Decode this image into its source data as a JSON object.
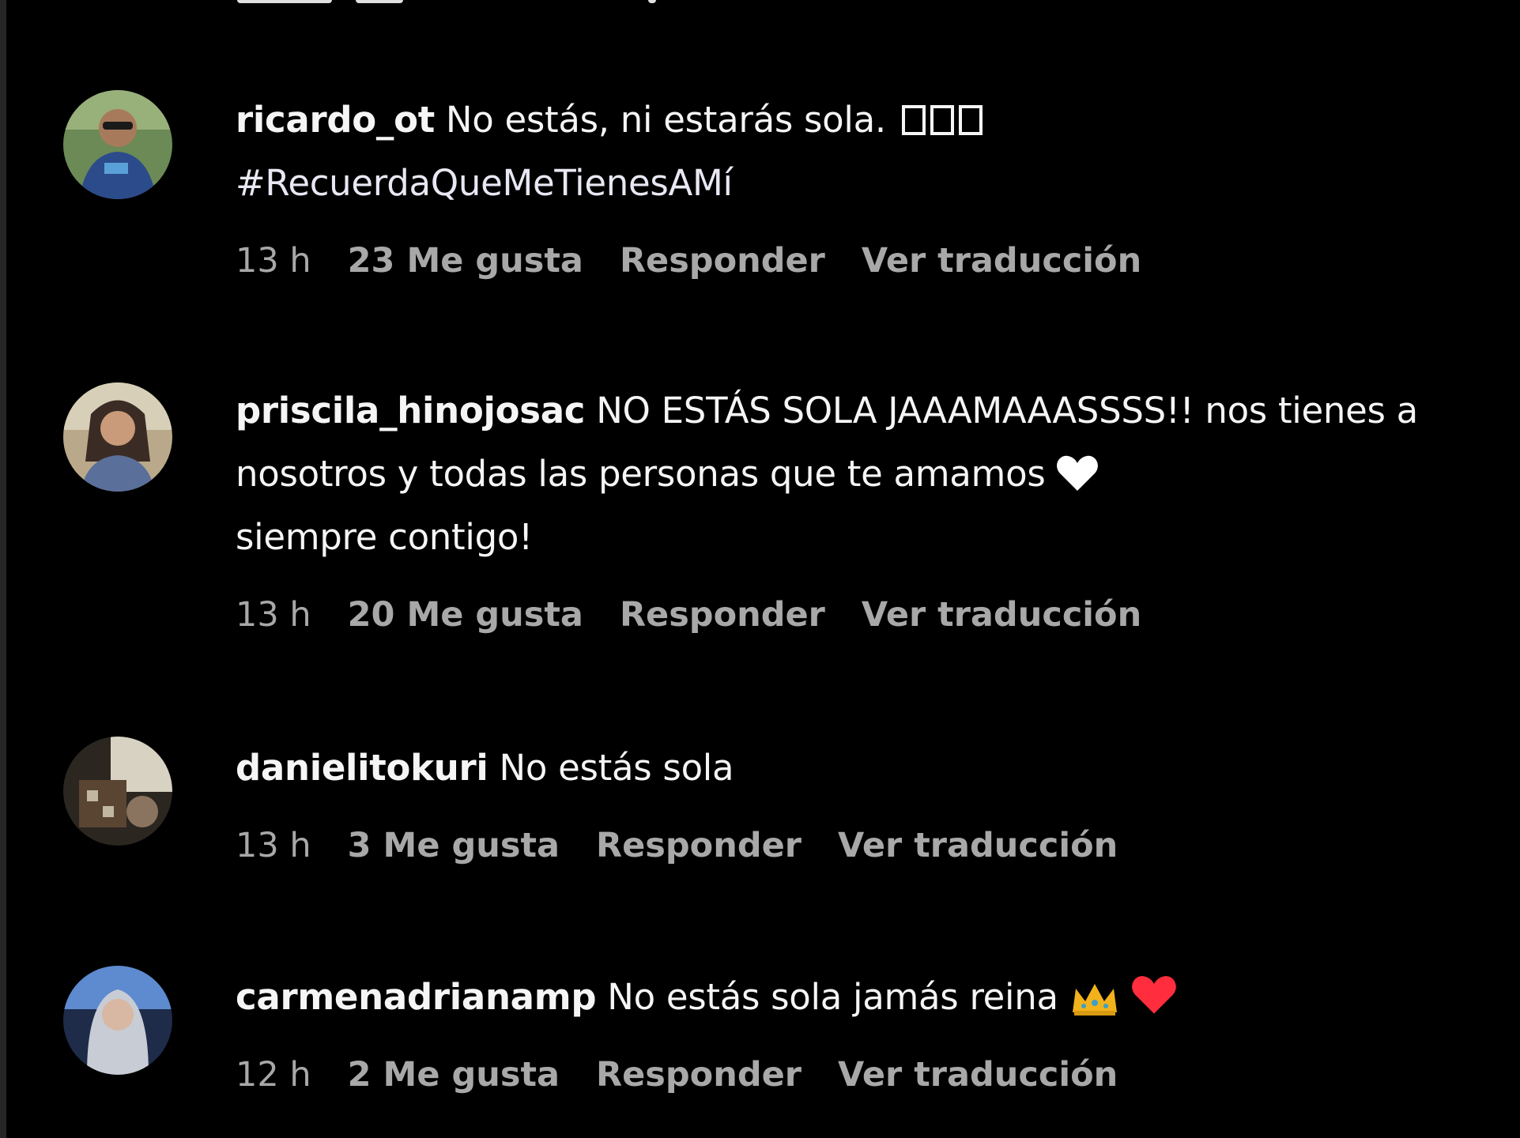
{
  "comments": [
    {
      "username": "ricardo_ot",
      "text": "No estás, ni estarás sola.",
      "hashtag": "#RecuerdaQueMeTienesAMí",
      "time": "13 h",
      "likes": "23 Me gusta",
      "reply": "Responder",
      "translate": "Ver traducción"
    },
    {
      "username": "priscila_hinojosac",
      "text": "NO ESTÁS SOLA JAAAMAAASSSS!! nos tienes a nosotros y todas las personas que te amamos",
      "text_end": "siempre contigo!",
      "time": "13 h",
      "likes": "20 Me gusta",
      "reply": "Responder",
      "translate": "Ver traducción"
    },
    {
      "username": "danielitokuri",
      "text": "No estás sola",
      "time": "13 h",
      "likes": "3 Me gusta",
      "reply": "Responder",
      "translate": "Ver traducción"
    },
    {
      "username": "carmenadrianamp",
      "text": "No estás sola jamás reina",
      "time": "12 h",
      "likes": "2 Me gusta",
      "reply": "Responder",
      "translate": "Ver traducción"
    }
  ],
  "icons": {
    "white_heart": "white-heart-icon",
    "red_heart": "red-heart-icon",
    "crown": "crown-icon",
    "missing_glyph": "missing-glyph-icon"
  },
  "colors": {
    "background": "#000000",
    "text": "#f5f5f5",
    "meta": "#a8a8a8",
    "red_heart": "#ff2d3d"
  }
}
